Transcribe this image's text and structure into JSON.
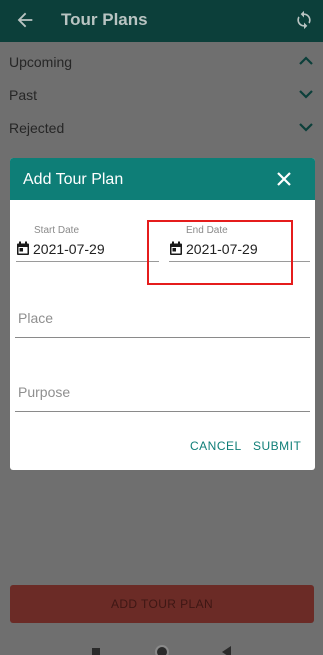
{
  "appbar": {
    "title": "Tour Plans",
    "back_icon": "arrow-back-icon",
    "refresh_icon": "refresh-icon"
  },
  "sections": [
    {
      "label": "Upcoming",
      "icon": "chevron-up-icon"
    },
    {
      "label": "Past",
      "icon": "chevron-down-icon"
    },
    {
      "label": "Rejected",
      "icon": "chevron-down-icon"
    }
  ],
  "dialog": {
    "title": "Add Tour Plan",
    "start_date": {
      "label": "Start Date",
      "value": "2021-07-29"
    },
    "end_date": {
      "label": "End Date",
      "value": "2021-07-29"
    },
    "place": {
      "placeholder": "Place",
      "value": ""
    },
    "purpose": {
      "placeholder": "Purpose",
      "value": ""
    },
    "cancel_label": "CANCEL",
    "submit_label": "SUBMIT"
  },
  "add_button": {
    "label": "ADD TOUR PLAN"
  },
  "colors": {
    "primary_dark": "#0c3f3a",
    "dialog_header": "#0e7e77",
    "accent_text": "#0e7e77",
    "add_button": "#6b2b26",
    "highlight": "#e51c1c"
  }
}
